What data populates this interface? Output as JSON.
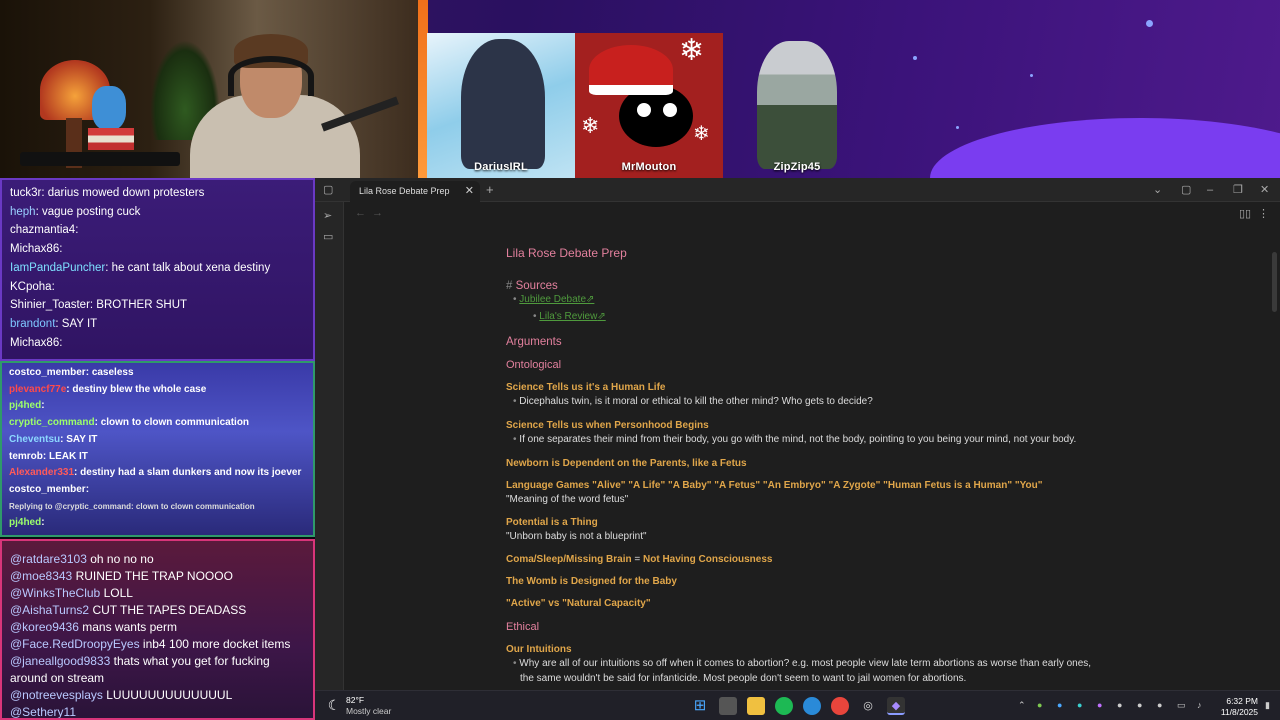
{
  "stream": {
    "participants": [
      "DariusIRL",
      "MrMouton",
      "ZipZip45"
    ]
  },
  "chat1": [
    {
      "user": "tuck3r",
      "text": "darius mowed down protesters",
      "color": "#ffffff"
    },
    {
      "user": "heph",
      "text": "vague posting cuck",
      "color": "#9ad0ff"
    },
    {
      "user": "chazmantia4",
      "text": "",
      "color": "#ffffff"
    },
    {
      "user": "Michax86",
      "text": "",
      "color": "#ffffff"
    },
    {
      "user": "IamPandaPuncher",
      "text": "he cant talk about xena destiny",
      "color": "#7ee0ff"
    },
    {
      "user": "KCpoha",
      "text": "",
      "color": "#ffffff"
    },
    {
      "user": "Shinier_Toaster",
      "text": "BROTHER SHUT",
      "color": "#ffffff"
    },
    {
      "user": "brandont",
      "text": "SAY  IT",
      "color": "#7ec8ff"
    },
    {
      "user": "Michax86",
      "text": "",
      "color": "#ffffff"
    }
  ],
  "chat2": [
    {
      "user": "costco_member",
      "text": "caseless",
      "color": "#ffffff"
    },
    {
      "user": "plevancf77e",
      "text": "destiny blew the whole case",
      "color": "#ff4a4a"
    },
    {
      "user": "pj4hed",
      "text": "",
      "color": "#9cff6a"
    },
    {
      "user": "cryptic_command",
      "text": "clown to clown communication",
      "color": "#9cff6a"
    },
    {
      "user": "Cheventsu",
      "text": "SAY IT",
      "color": "#8cd8ff"
    },
    {
      "user": "temrob",
      "text": "LEAK IT",
      "color": "#ffffff"
    },
    {
      "user": "Alexander331",
      "text": "destiny had a slam dunkers and now its joever",
      "color": "#ff5a5a"
    },
    {
      "user": "costco_member",
      "text": "",
      "color": "#ffffff"
    },
    {
      "user": "",
      "text": "Replying to @cryptic_command: clown to clown communication",
      "color": "#dddddd"
    },
    {
      "user": "pj4hed",
      "text": "",
      "color": "#9cff6a"
    }
  ],
  "chat3": [
    {
      "user": "@ratdare3103",
      "text": "oh no no no"
    },
    {
      "user": "@moe8343",
      "text": "RUINED THE TRAP NOOOO"
    },
    {
      "user": "@WinksTheClub",
      "text": "LOLL"
    },
    {
      "user": "@AishaTurns2",
      "text": "CUT THE TAPES DEADASS"
    },
    {
      "user": "@koreo9436",
      "text": "mans wants perm"
    },
    {
      "user": "@Face.RedDroopyEyes",
      "text": "inb4 100 more docket items"
    },
    {
      "user": "@janeallgood9833",
      "text": "thats what you get for fucking around on stream"
    },
    {
      "user": "@notreevesplays",
      "text": "LUUUUUUUUUUUUUL"
    },
    {
      "user": "@Sethery11",
      "text": ""
    }
  ],
  "app": {
    "tab_title": "Lila Rose Debate Prep",
    "doc_title": "Lila Rose Debate Prep",
    "sources_heading": "Sources",
    "link1": "Jubilee Debate",
    "link2": "Lila's Review",
    "arguments": "Arguments",
    "ontological": "Ontological",
    "h_science": "Science Tells us it's a Human Life",
    "b_science": "Dicephalus twin, is it moral or ethical to kill the other mind? Who gets to decide?",
    "h_person": "Science Tells us when Personhood Begins",
    "b_person": "If one separates their mind from their body, you go with the mind, not the body, pointing to you being your mind, not your body.",
    "h_newborn": "Newborn is Dependent on the Parents, like a Fetus",
    "h_language": "Language Games \"Alive\" \"A Life\" \"A Baby\" \"A Fetus\" \"An Embryo\" \"A Zygote\" \"Human Fetus is a Human\" \"You\"",
    "t_language": "\"Meaning of the word fetus\"",
    "h_potential": "Potential is a Thing",
    "t_potential": "\"Unborn baby is not a blueprint\"",
    "h_coma_a": "Coma/Sleep/Missing Brain",
    "h_coma_eq": "=",
    "h_coma_b": "Not Having Consciousness",
    "h_womb": "The Womb is Designed for the Baby",
    "h_active": "\"Active\" vs \"Natural Capacity\"",
    "ethical": "Ethical",
    "h_intuitions": "Our Intuitions",
    "b_intuitions_1": "Why are all of our intuitions so off when it comes to abortion? e.g. most people view late term abortions as worse than early ones,",
    "b_intuitions_2": "the same wouldn't be said for infanticide. Most people don't seem to want to jail women for abortions."
  },
  "taskbar": {
    "temp": "82°F",
    "weather": "Mostly clear",
    "time": "6:32 PM",
    "date": "11/8/2025"
  }
}
